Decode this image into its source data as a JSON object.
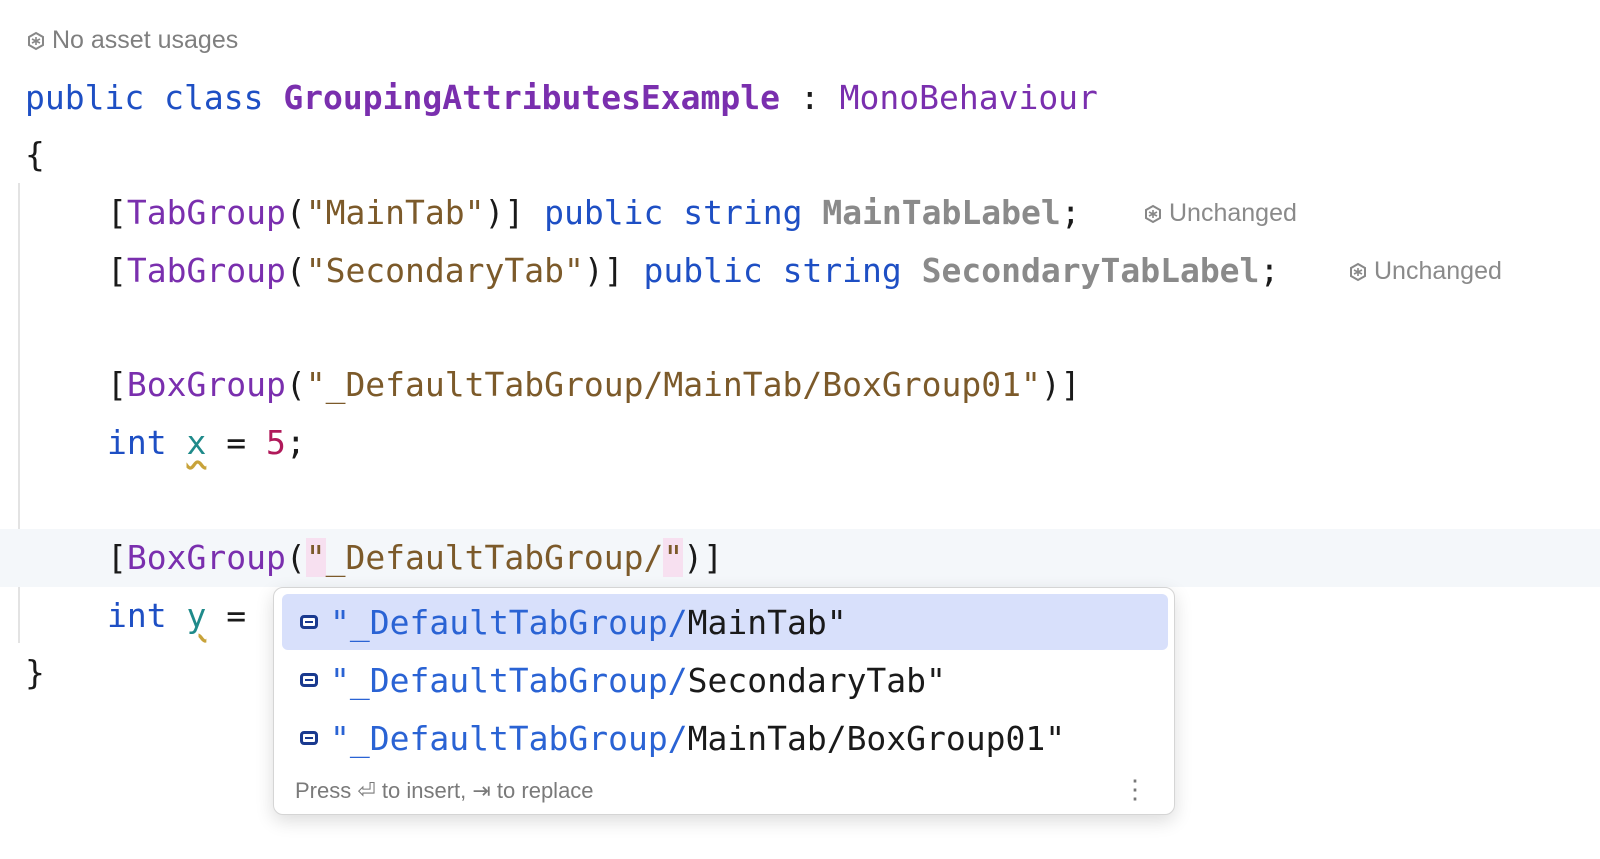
{
  "asset_hint": {
    "icon": "unity-icon",
    "text": "No asset usages"
  },
  "code": {
    "line1": {
      "kw1": "public",
      "kw2": "class",
      "class_name": "GroupingAttributesExample",
      "colon": ":",
      "base": "MonoBehaviour"
    },
    "open_brace": "{",
    "line3": {
      "bracket_open": "[",
      "attr": "TabGroup",
      "paren_open": "(",
      "arg": "\"MainTab\"",
      "paren_close": ")]",
      "kw1": "public",
      "kw2": "string",
      "field": "MainTabLabel",
      "semi": ";"
    },
    "line4": {
      "bracket_open": "[",
      "attr": "TabGroup",
      "paren_open": "(",
      "arg": "\"SecondaryTab\"",
      "paren_close": ")]",
      "kw1": "public",
      "kw2": "string",
      "field": "SecondaryTabLabel",
      "semi": ";"
    },
    "line6": {
      "bracket_open": "[",
      "attr": "BoxGroup",
      "paren_open": "(",
      "arg": "\"_DefaultTabGroup/MainTab/BoxGroup01\"",
      "paren_close": ")]"
    },
    "line7": {
      "type": "int",
      "ident": "x",
      "op": " = ",
      "value": "5",
      "semi": ";"
    },
    "line9": {
      "bracket_open": "[",
      "attr": "BoxGroup",
      "paren_open": "(",
      "quote_open": "\"",
      "arg_text": "_DefaultTabGroup/",
      "quote_close": "\"",
      "paren_close": ")]"
    },
    "line10": {
      "type": "int",
      "ident": "y",
      "op": " ="
    },
    "close_brace": "}"
  },
  "inlay_hints": [
    {
      "icon": "unity-icon",
      "text": "Unchanged"
    },
    {
      "icon": "unity-icon",
      "text": "Unchanged"
    }
  ],
  "completion": {
    "items": [
      {
        "icon": "enum-member-icon",
        "prefix": "\"_DefaultTabGroup/",
        "suffix": "MainTab\"",
        "selected": true
      },
      {
        "icon": "enum-member-icon",
        "prefix": "\"_DefaultTabGroup/",
        "suffix": "SecondaryTab\"",
        "selected": false
      },
      {
        "icon": "enum-member-icon",
        "prefix": "\"_DefaultTabGroup/",
        "suffix": "MainTab/BoxGroup01\"",
        "selected": false
      }
    ],
    "footer": "Press ⏎ to insert, ⇥ to replace",
    "more_icon": "⋮"
  },
  "colors": {
    "keyword": "#1e4fc4",
    "class": "#7a2fae",
    "string": "#7c5a2a",
    "number": "#b0195a",
    "selection": "#d8e0fb",
    "match": "#2a63d4"
  }
}
